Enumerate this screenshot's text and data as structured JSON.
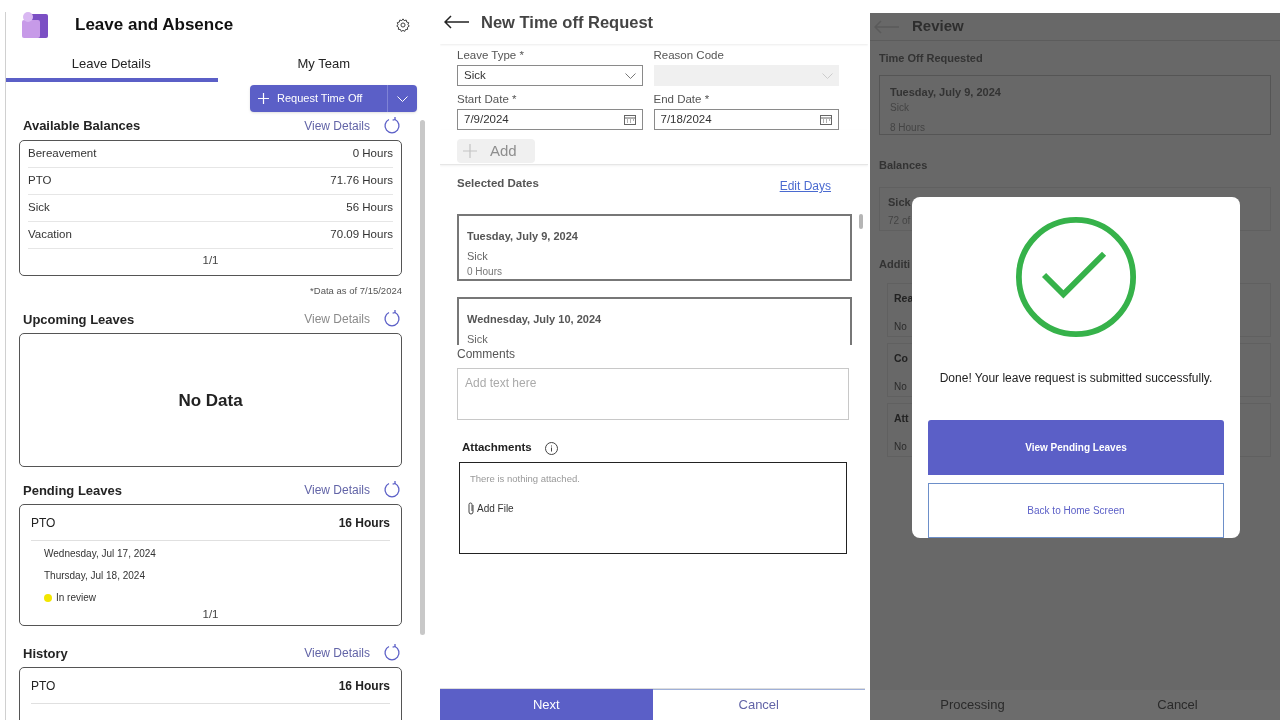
{
  "app": {
    "title": "Leave and Absence"
  },
  "tabs": [
    {
      "label": "Leave Details",
      "selected": true
    },
    {
      "label": "My Team",
      "selected": false
    }
  ],
  "request_button": {
    "label": "Request Time Off"
  },
  "sections": [
    {
      "kind": "balances",
      "title": "Available Balances",
      "link": "View Details",
      "disabled": false,
      "rows": [
        {
          "name": "Bereavement",
          "value": "0 Hours"
        },
        {
          "name": "PTO",
          "value": "71.76 Hours"
        },
        {
          "name": "Sick",
          "value": "56 Hours"
        },
        {
          "name": "Vacation",
          "value": "70.09 Hours"
        }
      ],
      "pager": "1/1",
      "footnote": "*Data as of 7/15/2024"
    },
    {
      "kind": "empty",
      "title": "Upcoming Leaves",
      "link": "View Details",
      "disabled": true,
      "message": "No Data"
    },
    {
      "kind": "leave",
      "title": "Pending Leaves",
      "link": "View Details",
      "disabled": false,
      "type": "PTO",
      "hours": "16 Hours",
      "dates": [
        "Wednesday, Jul 17, 2024",
        "Thursday, Jul 18, 2024"
      ],
      "status": {
        "label": "In review",
        "color": "#f2e600"
      },
      "pager": "1/1"
    },
    {
      "kind": "leave",
      "title": "History",
      "link": "View Details",
      "disabled": false,
      "type": "PTO",
      "hours": "16 Hours"
    }
  ],
  "request_form": {
    "title": "New Time off Request",
    "fields": [
      {
        "label": "Leave Type *",
        "value": "Sick",
        "kind": "dropdown",
        "disabled": false
      },
      {
        "label": "Reason Code",
        "kind": "dropdown",
        "disabled": true
      },
      {
        "label": "Start Date *",
        "value": "7/9/2024",
        "kind": "date",
        "disabled": false
      },
      {
        "label": "End Date *",
        "value": "7/18/2024",
        "kind": "date",
        "disabled": false
      }
    ],
    "add_button": {
      "label": "Add",
      "disabled": true
    },
    "selected_dates": {
      "title": "Selected Dates",
      "link": "Edit Days",
      "items": [
        {
          "date": "Tuesday, July 9, 2024",
          "type": "Sick",
          "hours": "0 Hours"
        },
        {
          "date": "Wednesday, July 10, 2024",
          "type": "Sick"
        }
      ]
    },
    "comments": {
      "label": "Comments",
      "placeholder": "Add text here"
    },
    "attachments": {
      "label": "Attachments",
      "empty_text": "There is nothing attached.",
      "add_label": "Add File"
    },
    "actions": [
      {
        "label": "Next",
        "primary": true
      },
      {
        "label": "Cancel",
        "primary": false
      }
    ]
  },
  "review": {
    "title": "Review",
    "requested_title": "Time Off Requested",
    "requested": {
      "date": "Tuesday, July 9, 2024",
      "type": "Sick",
      "hours": "8 Hours"
    },
    "balances_title": "Balances",
    "balance": {
      "name": "Sick",
      "detail": "72 of"
    },
    "additional_title": "Additi",
    "additional": [
      {
        "label": "Rea",
        "value": "No"
      },
      {
        "label": "Co",
        "value": "No"
      },
      {
        "label": "Att",
        "value": "No"
      }
    ],
    "actions": [
      {
        "label": "Processing"
      },
      {
        "label": "Cancel"
      }
    ]
  },
  "dialog": {
    "message": "Done! Your leave request is submitted successfully.",
    "actions": [
      {
        "label": "View Pending Leaves",
        "primary": true
      },
      {
        "label": "Back to Home Screen",
        "primary": false
      }
    ]
  }
}
